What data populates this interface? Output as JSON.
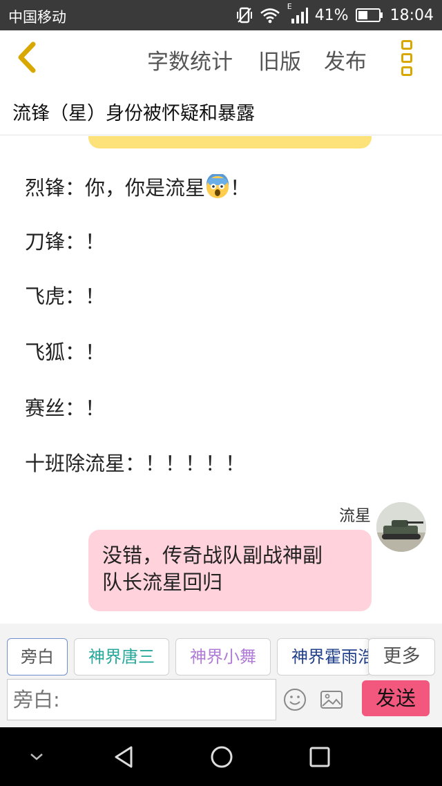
{
  "status_bar": {
    "carrier": "中国移动",
    "battery": "41%",
    "time": "18:04",
    "network": "E"
  },
  "toolbar": {
    "word_count": "字数统计",
    "old_version": "旧版",
    "publish": "发布"
  },
  "title": "流锋（星）身份被怀疑和暴露",
  "chat": {
    "lines": [
      {
        "text_before": "烈锋：你，你是流星",
        "emoji": "fearful-face-emoji",
        "text_after": "！"
      },
      {
        "text": "刀锋：！"
      },
      {
        "text": "飞虎：！"
      },
      {
        "text": "飞狐：！"
      },
      {
        "text": "赛丝：！"
      },
      {
        "text": "十班除流星：！！！！！"
      }
    ],
    "message": {
      "speaker": "流星",
      "line1": "没错，传奇战队副战神副",
      "line2": "队长流星回归"
    }
  },
  "roles": {
    "narrator": "旁白",
    "tang": "神界唐三",
    "wu": "神界小舞",
    "huo": "神界霍雨浩",
    "more": "更多"
  },
  "input": {
    "placeholder": "旁白:",
    "send": "发送"
  },
  "colors": {
    "accent": "#d8a800",
    "send_button": "#f2577e",
    "message_bubble": "#ffd2dc",
    "prev_bubble": "#fde27a"
  }
}
